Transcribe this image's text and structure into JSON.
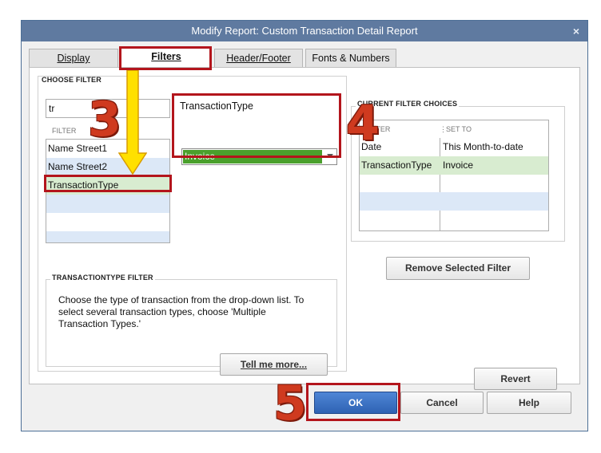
{
  "window": {
    "title": "Modify Report: Custom Transaction Detail Report",
    "close_glyph": "×"
  },
  "tabs": [
    {
      "label": "Display",
      "active": false
    },
    {
      "label": "Filters",
      "active": true
    },
    {
      "label": "Header/Footer",
      "active": false
    },
    {
      "label": "Fonts & Numbers",
      "active": false
    }
  ],
  "choose_filter": {
    "title": "CHOOSE FILTER",
    "search_value": "tr",
    "column_label": "FILTER",
    "items": [
      "Name Street1",
      "Name Street2",
      "TransactionType"
    ],
    "selected_index": 2
  },
  "filter_setting": {
    "label": "TransactionType",
    "dropdown_value": "Invoice"
  },
  "description": {
    "title": "TRANSACTIONTYPE FILTER",
    "text": "Choose the type of transaction from the drop-down list. To select several transaction types, choose 'Multiple Transaction Types.'",
    "tell_more": "Tell me more..."
  },
  "current": {
    "title": "CURRENT FILTER CHOICES",
    "col_filter": "FILTER",
    "col_set_to": "SET TO",
    "rows": [
      {
        "filter": "Date",
        "set_to": "This Month-to-date"
      },
      {
        "filter": "TransactionType",
        "set_to": "Invoice"
      }
    ],
    "remove_button": "Remove Selected Filter",
    "revert_button": "Revert"
  },
  "footer": {
    "ok": "OK",
    "cancel": "Cancel",
    "help": "Help"
  },
  "annotations": {
    "step3": "3",
    "step4": "4",
    "step5": "5"
  },
  "colors": {
    "title_bar": "#5f7aa0",
    "selected_green": "#d8ecd0",
    "dropdown_green": "#4aa02c",
    "alt_row_blue": "#dce8f7",
    "highlight_red": "#b3151c",
    "arrow_yellow": "#ffe000",
    "ok_blue": "#3a72c4"
  }
}
